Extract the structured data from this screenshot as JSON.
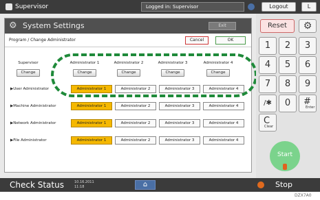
{
  "topbar": {
    "user": "Supervisor",
    "status": "Logged in: Supervisor",
    "logout": "Logout",
    "extra": "L"
  },
  "window": {
    "title": "System Settings",
    "exit": "Exit",
    "subtitle": "Program / Change Administrator",
    "cancel": "Cancel",
    "ok": "OK"
  },
  "columns": [
    {
      "header": "Supervisor",
      "button": "Change"
    },
    {
      "header": "Administrator 1",
      "button": "Change"
    },
    {
      "header": "Administrator 2",
      "button": "Change"
    },
    {
      "header": "Administrator 3",
      "button": "Change"
    },
    {
      "header": "Administrator 4",
      "button": "Change"
    }
  ],
  "rows": [
    {
      "label": "▶User Administrator",
      "options": [
        "Administrator 1",
        "Administrator 2",
        "Administrator 3",
        "Administrator 4"
      ],
      "selected": 0
    },
    {
      "label": "▶Machine Administrator",
      "options": [
        "Administrator 1",
        "Administrator 2",
        "Administrator 3",
        "Administrator 4"
      ],
      "selected": 0
    },
    {
      "label": "▶Network Administrator",
      "options": [
        "Administrator 1",
        "Administrator 2",
        "Administrator 3",
        "Administrator 4"
      ],
      "selected": 0
    },
    {
      "label": "▶File Administrator",
      "options": [
        "Administrator 1",
        "Administrator 2",
        "Administrator 3",
        "Administrator 4"
      ],
      "selected": 0
    }
  ],
  "sidebar": {
    "reset": "Reset",
    "keys": [
      "1",
      "2",
      "3",
      "4",
      "5",
      "6",
      "7",
      "8",
      "9",
      "/✱",
      "0",
      "#"
    ],
    "enter_label": "Enter",
    "clear_label": "C",
    "clear_small": "Clear",
    "start": "Start"
  },
  "bottombar": {
    "check_status": "Check Status",
    "date": "10.16.2011",
    "time": "11:18",
    "home": "⌂",
    "stop": "Stop"
  },
  "figure_ref": "DZX7A0",
  "colors": {
    "selected": "#f5b800",
    "highlight": "#1f8a3a",
    "start": "#7bd38c"
  }
}
